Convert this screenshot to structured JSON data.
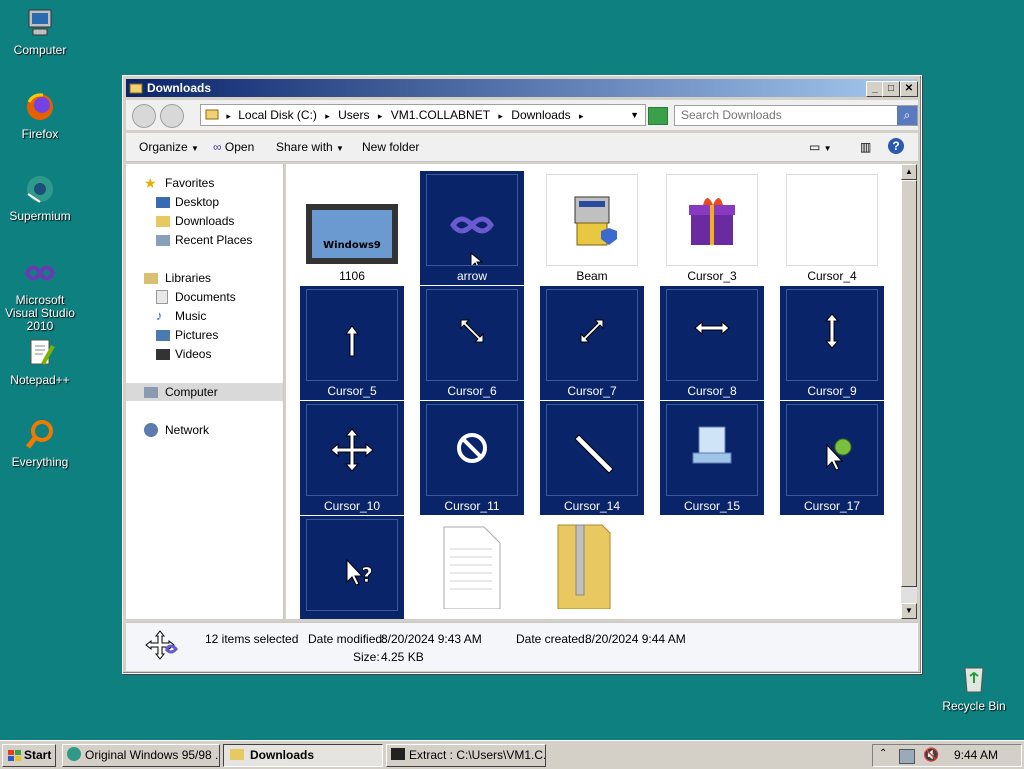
{
  "desktop": {
    "icons": [
      {
        "label": "Computer"
      },
      {
        "label": "Firefox"
      },
      {
        "label": "Supermium"
      },
      {
        "label": "Microsoft Visual Studio 2010"
      },
      {
        "label": "Notepad++"
      },
      {
        "label": "Everything"
      },
      {
        "label": "Recycle Bin"
      }
    ]
  },
  "window": {
    "title": "Downloads",
    "address": {
      "crumbs": [
        "Local Disk (C:)",
        "Users",
        "VM1.COLLABNET",
        "Downloads"
      ]
    },
    "search": {
      "placeholder": "Search Downloads"
    },
    "toolbar": {
      "organize": "Organize",
      "open": "Open",
      "share_with": "Share with",
      "new_folder": "New folder"
    },
    "nav": {
      "favorites": "Favorites",
      "desktop": "Desktop",
      "downloads": "Downloads",
      "recent": "Recent Places",
      "libraries": "Libraries",
      "documents": "Documents",
      "music": "Music",
      "pictures": "Pictures",
      "videos": "Videos",
      "computer": "Computer",
      "network": "Network"
    },
    "files": [
      {
        "name": "1106",
        "selected": false
      },
      {
        "name": "arrow",
        "selected": true
      },
      {
        "name": "Beam",
        "selected": false
      },
      {
        "name": "Cursor_3",
        "selected": false
      },
      {
        "name": "Cursor_4",
        "selected": false
      },
      {
        "name": "Cursor_5",
        "selected": true
      },
      {
        "name": "Cursor_6",
        "selected": true
      },
      {
        "name": "Cursor_7",
        "selected": true
      },
      {
        "name": "Cursor_8",
        "selected": true
      },
      {
        "name": "Cursor_9",
        "selected": true
      },
      {
        "name": "Cursor_10",
        "selected": true
      },
      {
        "name": "Cursor_11",
        "selected": true
      },
      {
        "name": "Cursor_14",
        "selected": true
      },
      {
        "name": "Cursor_15",
        "selected": true
      },
      {
        "name": "Cursor_17",
        "selected": true
      },
      {
        "name": "",
        "selected": true
      },
      {
        "name": "",
        "selected": false
      },
      {
        "name": "",
        "selected": false
      }
    ],
    "details": {
      "count": "12 items selected",
      "modified_label": "Date modified:",
      "modified_value": "8/20/2024 9:43 AM",
      "created_label": "Date created:",
      "created_value": "8/20/2024 9:44 AM",
      "size_label": "Size:",
      "size_value": "4.25 KB"
    }
  },
  "taskbar": {
    "start": "Start",
    "tasks": [
      "Original Windows 95/98 ...",
      "Downloads",
      "Extract : C:\\Users\\VM1.C..."
    ],
    "clock": "9:44 AM"
  },
  "colors": {
    "desktop": "#0f8080",
    "selection": "#0a246a",
    "titlebar": "#0a246a"
  }
}
